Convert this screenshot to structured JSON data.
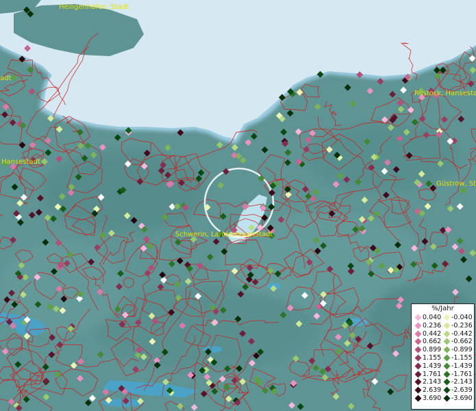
{
  "cities": [
    {
      "name": "Heiligenhafen, Stadt"
    },
    {
      "name": "Rostock, Hansesta"
    },
    {
      "name": "Hansestadt"
    },
    {
      "name": "Güstrow, St"
    },
    {
      "name": "Schwerin, Landeshauptstadt"
    },
    {
      "name": "adt"
    }
  ],
  "legend": {
    "title": "%/Jahr",
    "rows": [
      {
        "pos": "0.040",
        "neg": "-0.040",
        "pos_color": "#f7b6dc",
        "neg_color": "#eaf5b4"
      },
      {
        "pos": "0.236",
        "neg": "-0.236",
        "pos_color": "#eb92c3",
        "neg_color": "#d2ec9c"
      },
      {
        "pos": "0.442",
        "neg": "-0.442",
        "pos_color": "#d97aa8",
        "neg_color": "#b6dc86"
      },
      {
        "pos": "0.662",
        "neg": "-0.662",
        "pos_color": "#c76490",
        "neg_color": "#98c96f"
      },
      {
        "pos": "0.899",
        "neg": "-0.899",
        "pos_color": "#b24f7a",
        "neg_color": "#7cb55a"
      },
      {
        "pos": "1.155",
        "neg": "-1.155",
        "pos_color": "#9b3d63",
        "neg_color": "#5e9f47"
      },
      {
        "pos": "1.439",
        "neg": "-1.439",
        "pos_color": "#842d4e",
        "neg_color": "#438a36"
      },
      {
        "pos": "1.761",
        "neg": "-1.761",
        "pos_color": "#6c1f3b",
        "neg_color": "#2b7426"
      },
      {
        "pos": "2.143",
        "neg": "-2.143",
        "pos_color": "#55132a",
        "neg_color": "#185e19"
      },
      {
        "pos": "2.639",
        "neg": "-2.639",
        "pos_color": "#3e0a1b",
        "neg_color": "#0b4710"
      },
      {
        "pos": "3.690",
        "neg": "-3.690",
        "pos_color": "#28040e",
        "neg_color": "#033008"
      }
    ]
  },
  "marker_palette": [
    "#f7b6dc",
    "#eb92c3",
    "#d97aa8",
    "#c76490",
    "#b24f7a",
    "#9b3d63",
    "#842d4e",
    "#6c1f3b",
    "#55132a",
    "#3e0a1b",
    "#28040e",
    "#eaf5b4",
    "#d2ec9c",
    "#b6dc86",
    "#98c96f",
    "#7cb55a",
    "#5e9f47",
    "#438a36",
    "#2b7426",
    "#185e19",
    "#0b4710",
    "#033008",
    "#ffffff"
  ],
  "colors": {
    "sea": "#d6e9f2",
    "land": "#5f9494",
    "boundaries": "#d21c1c",
    "label": "#e4e400"
  }
}
